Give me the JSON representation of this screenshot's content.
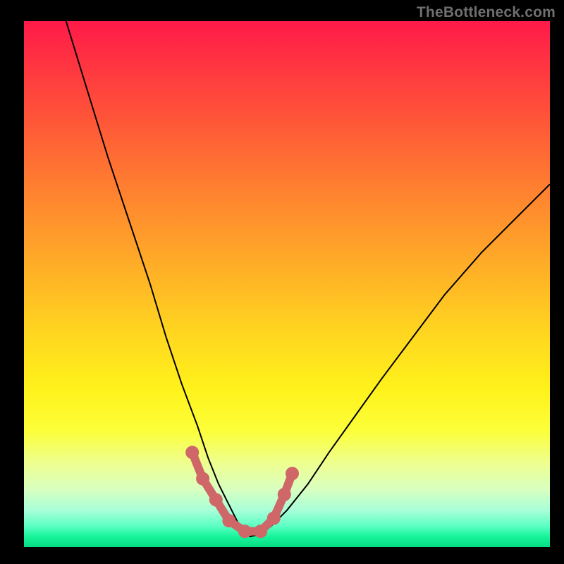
{
  "watermark": "TheBottleneck.com",
  "colors": {
    "background": "#000000",
    "curve": "#000000",
    "marker": "#cf6768",
    "gradient_top": "#ff1a49",
    "gradient_bottom": "#07db82"
  },
  "chart_data": {
    "type": "line",
    "title": "",
    "xlabel": "",
    "ylabel": "",
    "xlim": [
      0,
      100
    ],
    "ylim": [
      0,
      100
    ],
    "series": [
      {
        "name": "bottleneck-curve",
        "x": [
          8,
          12,
          16,
          20,
          24,
          27,
          30,
          33,
          35,
          37,
          38.5,
          40,
          41,
          42,
          43,
          45,
          47,
          50,
          54,
          58,
          63,
          68,
          74,
          80,
          87,
          94,
          100
        ],
        "y": [
          100,
          87,
          74,
          62,
          50,
          40,
          31,
          23,
          17,
          12,
          9,
          6,
          4,
          2.5,
          2,
          2.5,
          4,
          7,
          12,
          18,
          25,
          32,
          40,
          48,
          56,
          63,
          69
        ]
      }
    ],
    "markers": {
      "name": "highlighted-points",
      "x": [
        32,
        34,
        36.5,
        39,
        42,
        45,
        47.5,
        49.5,
        51
      ],
      "y": [
        18,
        13,
        9,
        5,
        3,
        3,
        5.5,
        10,
        14
      ]
    },
    "annotations": []
  }
}
